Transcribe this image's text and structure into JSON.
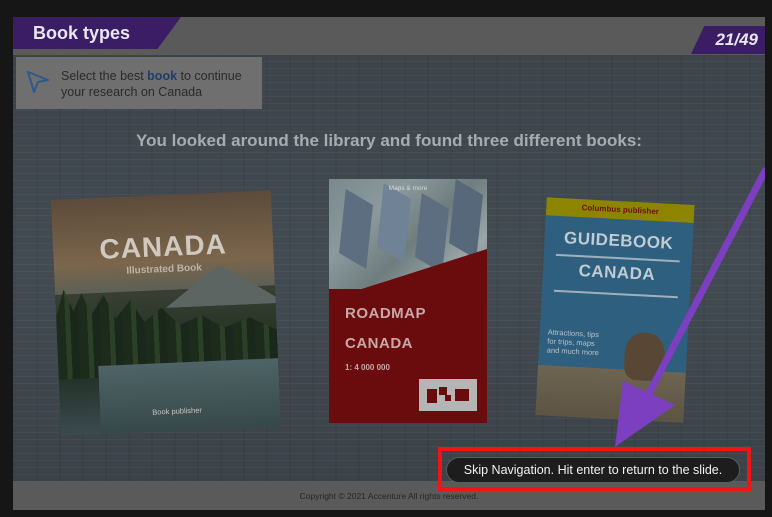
{
  "slide": {
    "title": "Book types",
    "counter": "21/49",
    "instruction": {
      "text_before": "Select the best ",
      "keyword": "book",
      "text_after": " to continue your research on Canada"
    },
    "headline": "You looked around the library and found three different books:"
  },
  "books": [
    {
      "title": "CANADA",
      "subtitle": "Illustrated Book",
      "publisher": "Book publisher"
    },
    {
      "tag": "Maps & more",
      "title_line1": "ROADMAP",
      "title_line2": "CANADA",
      "scale": "1: 4 000 000"
    },
    {
      "publisher": "Columbus publisher",
      "title_line1": "GUIDEBOOK",
      "title_line2": "CANADA",
      "description": "Attractions, tips for trips, maps and much more"
    }
  ],
  "footer": {
    "copyright": "Copyright © 2021 Accenture All rights reserved."
  },
  "skip_navigation": {
    "label": "Skip Navigation. Hit enter to return to the slide."
  },
  "colors": {
    "accent_purple": "#3b1d66",
    "annotation_arrow": "#7b3fc0",
    "highlight_red": "#f01414"
  }
}
